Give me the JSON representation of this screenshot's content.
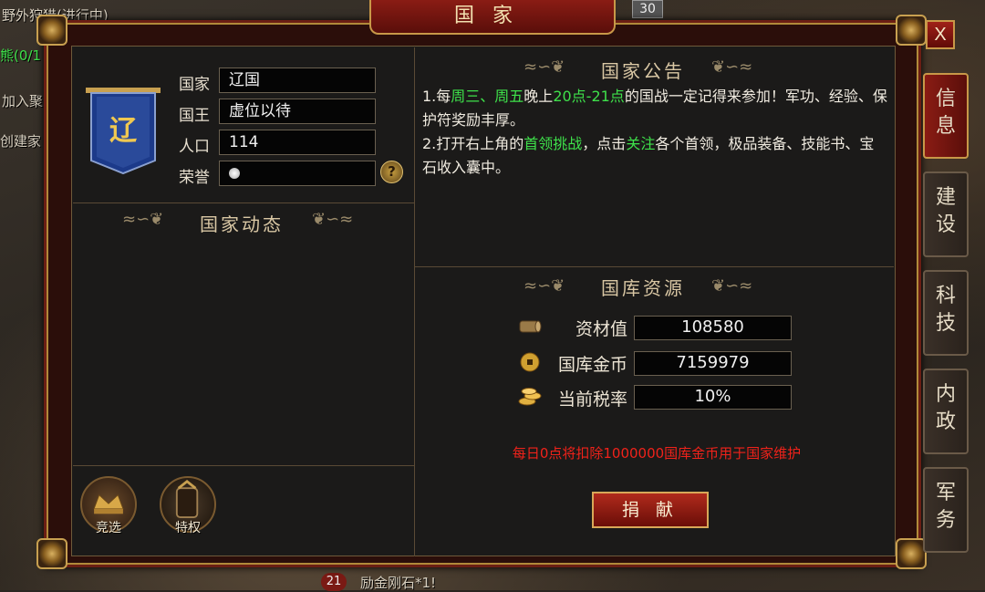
{
  "background": {
    "top_left_text": "野外狩猎(进行中)",
    "left_text_1": "熊(0/1",
    "left_text_2": "加入聚",
    "left_text_3": "创建家",
    "bottom_text": "励金刚石*1!",
    "badge_30": "30",
    "badge_21": "21"
  },
  "window": {
    "title": "国家",
    "close_label": "X"
  },
  "side_tabs": [
    {
      "label": "信息",
      "active": true
    },
    {
      "label": "建设",
      "active": false
    },
    {
      "label": "科技",
      "active": false
    },
    {
      "label": "内政",
      "active": false
    },
    {
      "label": "军务",
      "active": false
    }
  ],
  "country_info": {
    "banner_char": "辽",
    "country_label": "国家",
    "country_value": "辽国",
    "king_label": "国王",
    "king_value": "虚位以待",
    "population_label": "人口",
    "population_value": "114",
    "honor_label": "荣誉",
    "honor_help": "?"
  },
  "dynamics": {
    "title": "国家动态"
  },
  "announcement": {
    "title": "国家公告",
    "line1_prefix": "1.每",
    "line1_days": "周三、周五",
    "line1_mid": "晚上",
    "line1_time": "20点-21点",
    "line1_suffix": "的国战一定记得来参加！军功、经验、保护符奖励丰厚。",
    "line2_prefix": "2.打开右上角的",
    "line2_link1": "首领挑战",
    "line2_mid": "，点击",
    "line2_link2": "关注",
    "line2_suffix": "各个首领，极品装备、技能书、宝石收入囊中。"
  },
  "treasury": {
    "title": "国库资源",
    "rows": [
      {
        "icon": "wood-log-icon",
        "label": "资材值",
        "value": "108580"
      },
      {
        "icon": "gold-coin-icon",
        "label": "国库金币",
        "value": "7159979"
      },
      {
        "icon": "coin-stack-icon",
        "label": "当前税率",
        "value": "10%"
      }
    ],
    "warning": "每日0点将扣除1000000国库金币用于国家维护",
    "donate_label": "捐 献"
  },
  "bottom_buttons": [
    {
      "label": "竞选",
      "icon": "crown-throne-icon"
    },
    {
      "label": "特权",
      "icon": "privilege-emblem-icon"
    }
  ],
  "colors": {
    "frame_red": "#6b1e14",
    "gold_trim": "#c89848",
    "highlight_green": "#3ee04a",
    "warning_red": "#f0221a"
  }
}
